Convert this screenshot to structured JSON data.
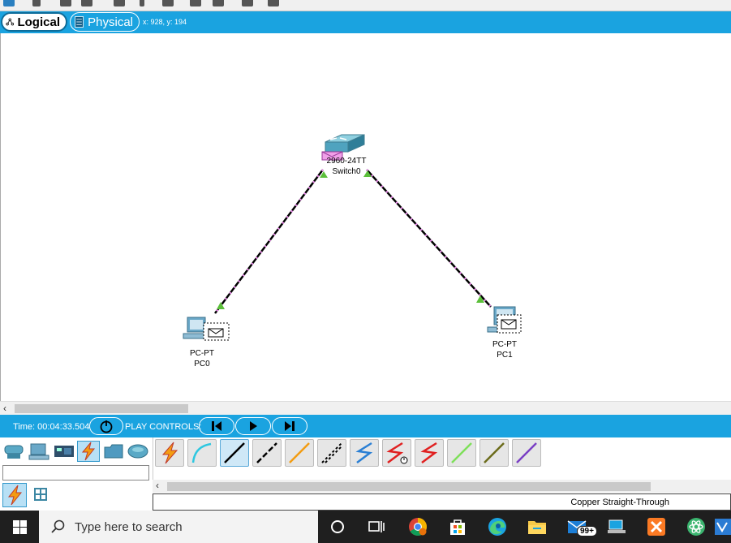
{
  "mode_bar": {
    "logical_label": "Logical",
    "physical_label": "Physical",
    "coords": "x: 928, y: 194"
  },
  "devices": {
    "switch0": {
      "model": "2960-24TT",
      "name": "Switch0"
    },
    "pc0": {
      "model": "PC-PT",
      "name": "PC0"
    },
    "pc1": {
      "model": "PC-PT",
      "name": "PC1"
    }
  },
  "realtime": {
    "time_label": "Time: 00:04:33.504",
    "play_controls_label": "PLAY CONTROLS:"
  },
  "cable_panel": {
    "selected_cable_name": "Copper Straight-Through",
    "cable_icons": [
      "automatic-connection-icon",
      "console-cable-icon",
      "copper-straight-through-icon",
      "copper-cross-over-icon",
      "fiber-icon",
      "phone-cable-icon",
      "coaxial-icon",
      "serial-dce-icon",
      "serial-dte-icon",
      "octal-cable-icon",
      "iot-custom-cable-icon",
      "usb-cable-icon"
    ]
  },
  "taskbar": {
    "search_placeholder": "Type here to search",
    "mail_badge": "99+"
  },
  "colors": {
    "accent_blue": "#1aa3e0",
    "link_up_green": "#5bbf3a",
    "traffic_pink": "#e888e8"
  }
}
